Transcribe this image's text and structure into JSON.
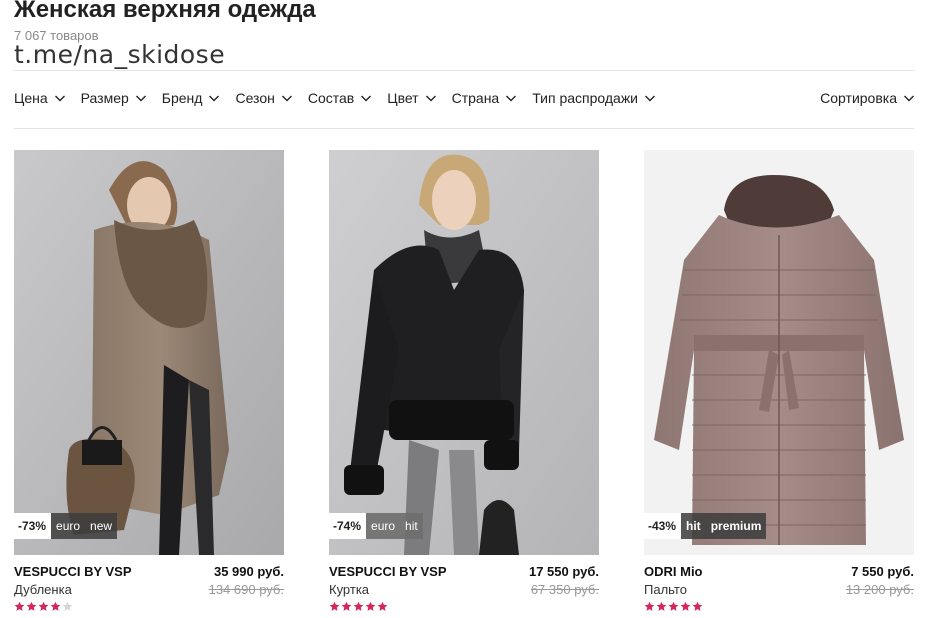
{
  "header": {
    "title": "Женская верхняя одежда",
    "count": "7 067 товаров",
    "watermark": "t.me/na_skidose"
  },
  "filters": [
    {
      "label": "Цена"
    },
    {
      "label": "Размер"
    },
    {
      "label": "Бренд"
    },
    {
      "label": "Сезон"
    },
    {
      "label": "Состав"
    },
    {
      "label": "Цвет"
    },
    {
      "label": "Страна"
    },
    {
      "label": "Тип распродажи"
    }
  ],
  "sort": {
    "label": "Сортировка"
  },
  "colors": {
    "star_active": "#d4275a",
    "star_inactive": "#d6d6d6",
    "badge_dark": "#3c3c3c"
  },
  "products": [
    {
      "brand": "VESPUCCI BY VSP",
      "type": "Дубленка",
      "price": "35 990 руб.",
      "old_price": "134 690 руб.",
      "discount": "-73%",
      "tags": [
        "euro",
        "new"
      ],
      "rating": 4,
      "image": "model-in-shearling-coat"
    },
    {
      "brand": "VESPUCCI BY VSP",
      "type": "Куртка",
      "price": "17 550 руб.",
      "old_price": "67 350 руб.",
      "discount": "-74%",
      "tags": [
        "euro",
        "hit"
      ],
      "rating": 5,
      "image": "model-in-leather-jacket"
    },
    {
      "brand": "ODRI Mio",
      "type": "Пальто",
      "price": "7 550 руб.",
      "old_price": "13 200 руб.",
      "discount": "-43%",
      "tags": [
        "hit",
        "premium"
      ],
      "rating": 5,
      "image": "puffer-coat"
    }
  ]
}
